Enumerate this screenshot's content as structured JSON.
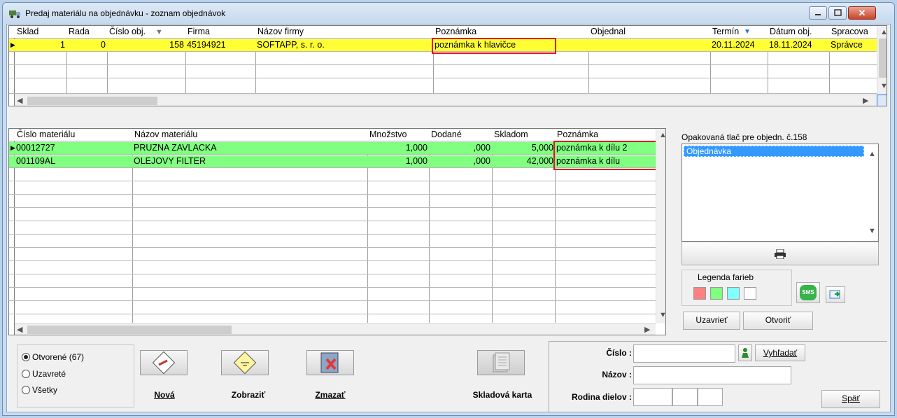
{
  "window": {
    "title": "Predaj materiálu na objednávku - zoznam objednávok",
    "colors": {
      "selected_row": "#ffff33",
      "items_row": "#80ff80",
      "highlight_box": "#e0141e"
    }
  },
  "orders_grid": {
    "columns": [
      "Sklad",
      "Rada",
      "Číslo obj.",
      "Firma",
      "Názov firmy",
      "Poznámka",
      "Objednal",
      "Termín",
      "Dátum obj.",
      "Spracova"
    ],
    "rows": [
      {
        "sklad": "1",
        "rada": "0",
        "cislo": "158",
        "firma": "45194921",
        "nazov": "SOFTAPP, s. r. o.",
        "poznamka": "poznámka k hlavičce",
        "objednal": "",
        "termin": "20.11.2024",
        "datum": "18.11.2024",
        "spracoval": "Správce"
      }
    ]
  },
  "items_grid": {
    "columns": [
      "Číslo materiálu",
      "Názov materiálu",
      "Množstvo",
      "Dodané",
      "Skladom",
      "Poznámka"
    ],
    "rows": [
      {
        "cislo": "00012727",
        "nazov": "PRUZNA ZAVLACKA",
        "mnozstvo": "1,000",
        "dodane": ",000",
        "skladom": "5,000",
        "poznamka": "poznámka k dílu 2"
      },
      {
        "cislo": "001109AL",
        "nazov": "OLEJOVY FILTER",
        "mnozstvo": "1,000",
        "dodane": ",000",
        "skladom": "42,000",
        "poznamka": "poznámka k dílu"
      }
    ]
  },
  "reprint": {
    "title": "Opakovaná tlač pre objedn. č.158",
    "items": [
      "Objednávka"
    ]
  },
  "legend": {
    "title": "Legenda farieb",
    "colors": [
      "#ff8080",
      "#80ff80",
      "#80ffff",
      "#ffffff"
    ]
  },
  "buttons": {
    "uzavriet": "Uzavrieť",
    "otvorit": "Otvoriť",
    "nova": "Nová",
    "zobrazit": "Zobraziť",
    "zmazat": "Zmazať",
    "skladova_karta": "Skladová karta",
    "vyhladat": "Vyhľadať",
    "spat": "Späť",
    "sms": "SMS"
  },
  "filter": {
    "options": [
      "Otvorené (67)",
      "Uzavreté",
      "Všetky"
    ],
    "selected": "Otvorené (67)"
  },
  "search": {
    "cislo_label": "Číslo :",
    "nazov_label": "Názov :",
    "rodina_label": "Rodina dielov :"
  }
}
